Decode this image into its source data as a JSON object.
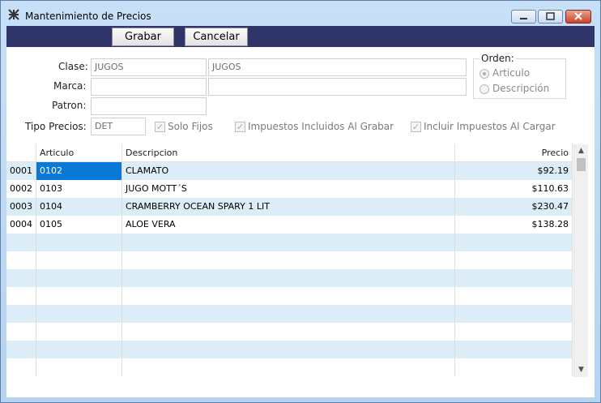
{
  "window": {
    "title": "Mantenimiento de Precios",
    "title_bar_buttons": [
      "minimize-icon",
      "maximize-icon",
      "close-icon"
    ],
    "app_icon": "app-icon"
  },
  "toolbar": {
    "save_label": "Grabar",
    "cancel_label": "Cancelar"
  },
  "form": {
    "clase_label": "Clase:",
    "clase_code": "JUGOS",
    "clase_desc": "JUGOS",
    "marca_label": "Marca:",
    "marca_code": "",
    "marca_desc": "",
    "patron_label": "Patron:",
    "patron_value": "",
    "tipo_precios_label": "Tipo Precios:",
    "tipo_precios_value": "DET",
    "solo_fijos_label": "Solo Fijos",
    "impuestos_incluidos_label": "Impuestos Incluidos Al Grabar",
    "incluir_impuestos_label": "Incluir Impuestos Al Cargar",
    "solo_fijos_checked": true,
    "impuestos_incluidos_checked": true,
    "incluir_impuestos_checked": true
  },
  "orden": {
    "title": "Orden:",
    "options": [
      "Articulo",
      "Descripción"
    ],
    "selected": "Articulo"
  },
  "grid": {
    "headers": [
      "",
      "Articulo",
      "Descripcion",
      "Precio"
    ],
    "rows": [
      {
        "num": "0001",
        "articulo": "0102",
        "descripcion": "CLAMATO",
        "precio": "$92.19"
      },
      {
        "num": "0002",
        "articulo": "0103",
        "descripcion": "JUGO MOTT´S",
        "precio": "$110.63"
      },
      {
        "num": "0003",
        "articulo": "0104",
        "descripcion": "CRAMBERRY OCEAN SPARY 1 LIT",
        "precio": "$230.47"
      },
      {
        "num": "0004",
        "articulo": "0105",
        "descripcion": "ALOE VERA",
        "precio": "$138.28"
      }
    ],
    "selected_cell": "0102",
    "colors": {
      "alt_row": "#dcedf7",
      "selection": "#0a78d7",
      "toolbar": "#2f3469"
    }
  }
}
